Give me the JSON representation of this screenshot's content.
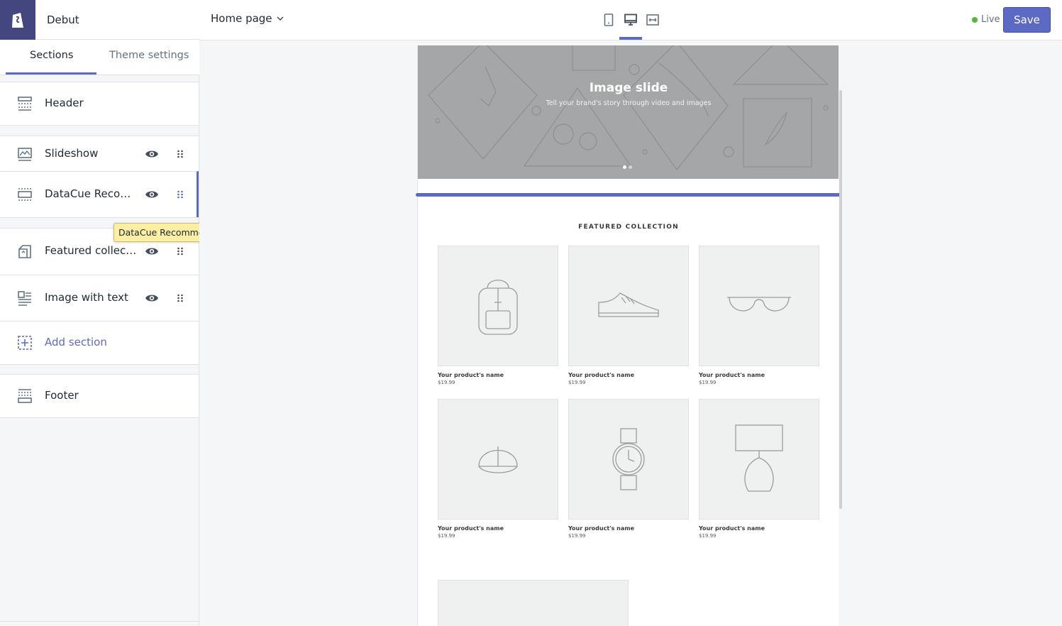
{
  "app": {
    "theme_name": "Debut"
  },
  "tabs": [
    {
      "label": "Sections"
    },
    {
      "label": "Theme settings"
    }
  ],
  "sections": {
    "header": "Header",
    "items": [
      {
        "label": "Slideshow"
      },
      {
        "label": "DataCue Recom..."
      },
      {
        "label": "Featured collect..."
      },
      {
        "label": "Image with text"
      }
    ],
    "add_section": "Add section",
    "footer": "Footer"
  },
  "tooltip": "DataCue Recommendations",
  "topbar": {
    "page_select": "Home page",
    "live_label": "Live",
    "save_label": "Save"
  },
  "preview": {
    "slide_title": "Image slide",
    "slide_subtitle": "Tell your brand's story through video and images",
    "featured_title": "FEATURED COLLECTION",
    "products": [
      {
        "name": "Your product's name",
        "price": "$19.99",
        "icon": "backpack-icon"
      },
      {
        "name": "Your product's name",
        "price": "$19.99",
        "icon": "sneaker-icon"
      },
      {
        "name": "Your product's name",
        "price": "$19.99",
        "icon": "glasses-icon"
      },
      {
        "name": "Your product's name",
        "price": "$19.99",
        "icon": "cap-icon"
      },
      {
        "name": "Your product's name",
        "price": "$19.99",
        "icon": "watch-icon"
      },
      {
        "name": "Your product's name",
        "price": "$19.99",
        "icon": "lamp-icon"
      }
    ]
  },
  "colors": {
    "accent": "#5c6ac4",
    "brand": "#43467f",
    "live": "#50b83c",
    "tooltip": "#fceea3"
  }
}
